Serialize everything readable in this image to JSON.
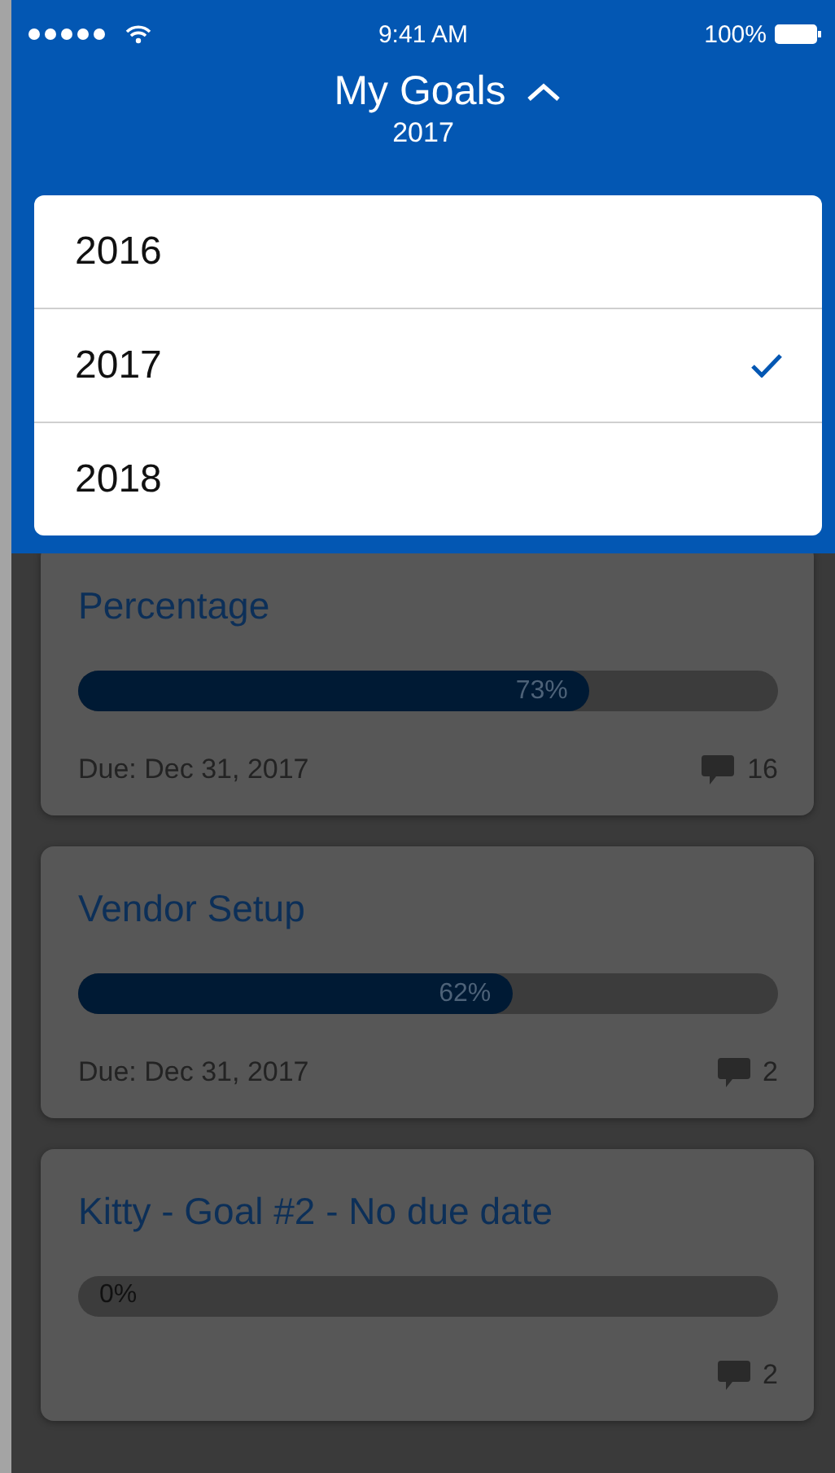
{
  "status_bar": {
    "time": "9:41 AM",
    "battery": "100%"
  },
  "header": {
    "title": "My Goals",
    "subtitle": "2017",
    "expanded": true
  },
  "year_menu": [
    {
      "label": "2016",
      "selected": false
    },
    {
      "label": "2017",
      "selected": true
    },
    {
      "label": "2018",
      "selected": false
    }
  ],
  "goals": [
    {
      "title": "Percentage",
      "level": 0.73,
      "percent": "73%",
      "due": "Due: Dec 31, 2017",
      "comments": "16"
    },
    {
      "title": "Vendor Setup",
      "level": 0.62,
      "percent": "62%",
      "due": "Due: Dec 31, 2017",
      "comments": "2"
    },
    {
      "title": "Kitty - Goal #2 - No due date",
      "level": 0,
      "percent": "0%",
      "comments": "2"
    }
  ]
}
